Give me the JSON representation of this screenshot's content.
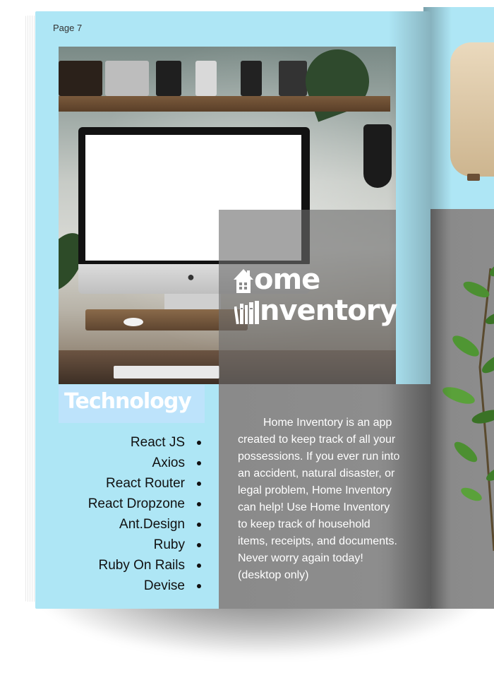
{
  "page": {
    "number_label": "Page 7"
  },
  "logo": {
    "line1_letters": "ome",
    "line2_letters": "nventory"
  },
  "technology": {
    "title": "Technology",
    "items": [
      "React JS",
      "Axios",
      "React Router",
      "React Dropzone",
      "Ant.Design",
      "Ruby",
      "Ruby On Rails",
      "Devise"
    ]
  },
  "description": {
    "text": "Home Inventory is an app created to keep track of all your possessions. If you ever run into an accident, natural disaster, or legal problem, Home Inventory can help! Use Home Inventory to keep track of household items, receipts, and documents. Never worry again today! (desktop only)"
  },
  "colors": {
    "page_background": "#aee6f5",
    "technology_header": "#bde3fb",
    "description_panel": "#8d8d8d"
  }
}
